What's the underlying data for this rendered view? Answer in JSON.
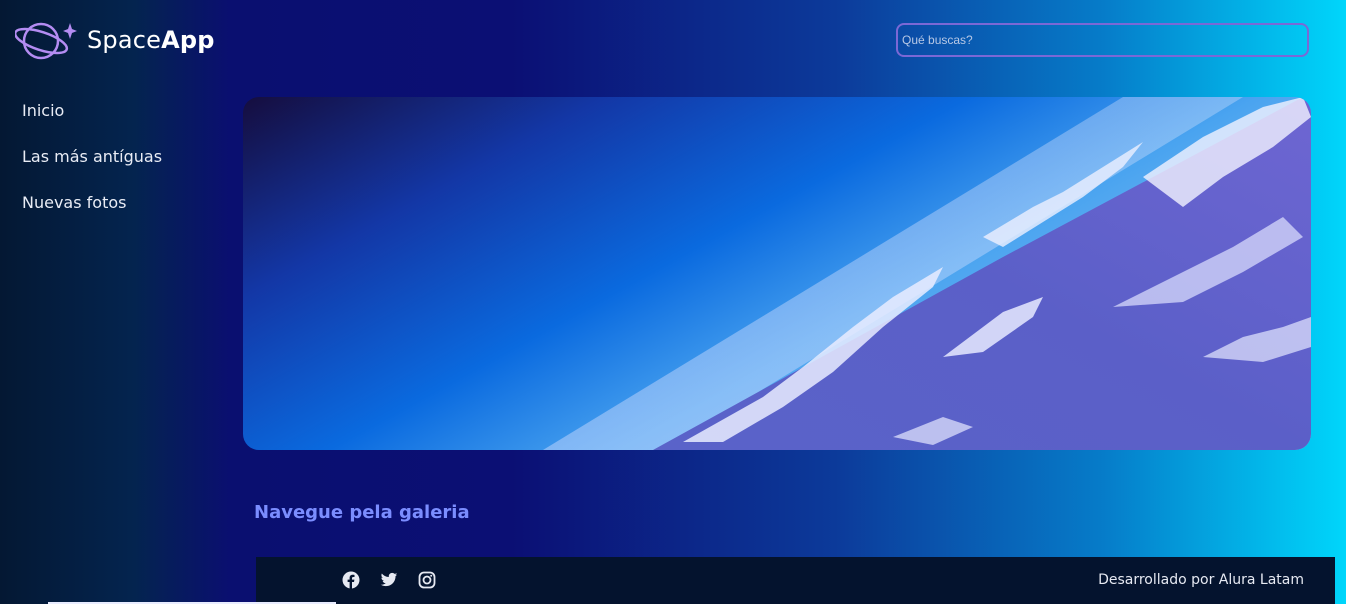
{
  "header": {
    "logo_text_regular": "Space",
    "logo_text_bold": "App",
    "search_placeholder": "Qué buscas?"
  },
  "sidebar": {
    "items": [
      {
        "label": "Inicio"
      },
      {
        "label": "Las más antíguas"
      },
      {
        "label": "Nuevas fotos"
      }
    ]
  },
  "banner": {
    "description_icon": "earth-from-space-image"
  },
  "main": {
    "gallery_title": "Navegue pela galeria"
  },
  "footer": {
    "social_icons": [
      "facebook-icon",
      "twitter-icon",
      "instagram-icon"
    ],
    "credits": "Desarrollado por Alura Latam"
  },
  "colors": {
    "accent": "#7b68d6",
    "gallery_title": "#7b8dff",
    "footer_bg": "#04132e"
  }
}
